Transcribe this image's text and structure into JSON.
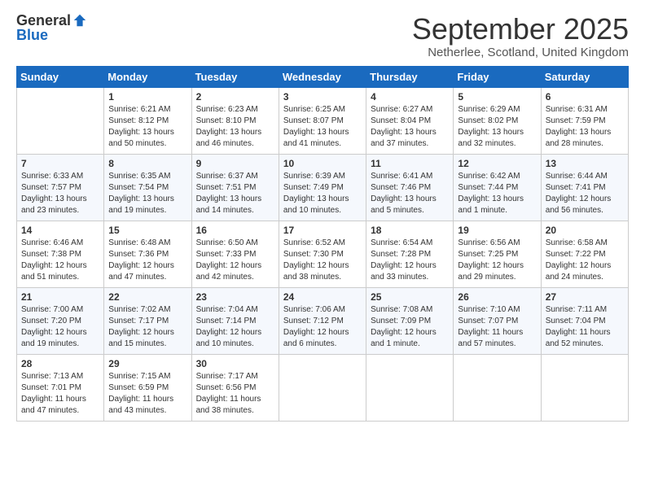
{
  "header": {
    "logo_general": "General",
    "logo_blue": "Blue",
    "title": "September 2025",
    "location": "Netherlee, Scotland, United Kingdom"
  },
  "weekdays": [
    "Sunday",
    "Monday",
    "Tuesday",
    "Wednesday",
    "Thursday",
    "Friday",
    "Saturday"
  ],
  "weeks": [
    [
      {
        "day": "",
        "text": ""
      },
      {
        "day": "1",
        "text": "Sunrise: 6:21 AM\nSunset: 8:12 PM\nDaylight: 13 hours\nand 50 minutes."
      },
      {
        "day": "2",
        "text": "Sunrise: 6:23 AM\nSunset: 8:10 PM\nDaylight: 13 hours\nand 46 minutes."
      },
      {
        "day": "3",
        "text": "Sunrise: 6:25 AM\nSunset: 8:07 PM\nDaylight: 13 hours\nand 41 minutes."
      },
      {
        "day": "4",
        "text": "Sunrise: 6:27 AM\nSunset: 8:04 PM\nDaylight: 13 hours\nand 37 minutes."
      },
      {
        "day": "5",
        "text": "Sunrise: 6:29 AM\nSunset: 8:02 PM\nDaylight: 13 hours\nand 32 minutes."
      },
      {
        "day": "6",
        "text": "Sunrise: 6:31 AM\nSunset: 7:59 PM\nDaylight: 13 hours\nand 28 minutes."
      }
    ],
    [
      {
        "day": "7",
        "text": "Sunrise: 6:33 AM\nSunset: 7:57 PM\nDaylight: 13 hours\nand 23 minutes."
      },
      {
        "day": "8",
        "text": "Sunrise: 6:35 AM\nSunset: 7:54 PM\nDaylight: 13 hours\nand 19 minutes."
      },
      {
        "day": "9",
        "text": "Sunrise: 6:37 AM\nSunset: 7:51 PM\nDaylight: 13 hours\nand 14 minutes."
      },
      {
        "day": "10",
        "text": "Sunrise: 6:39 AM\nSunset: 7:49 PM\nDaylight: 13 hours\nand 10 minutes."
      },
      {
        "day": "11",
        "text": "Sunrise: 6:41 AM\nSunset: 7:46 PM\nDaylight: 13 hours\nand 5 minutes."
      },
      {
        "day": "12",
        "text": "Sunrise: 6:42 AM\nSunset: 7:44 PM\nDaylight: 13 hours\nand 1 minute."
      },
      {
        "day": "13",
        "text": "Sunrise: 6:44 AM\nSunset: 7:41 PM\nDaylight: 12 hours\nand 56 minutes."
      }
    ],
    [
      {
        "day": "14",
        "text": "Sunrise: 6:46 AM\nSunset: 7:38 PM\nDaylight: 12 hours\nand 51 minutes."
      },
      {
        "day": "15",
        "text": "Sunrise: 6:48 AM\nSunset: 7:36 PM\nDaylight: 12 hours\nand 47 minutes."
      },
      {
        "day": "16",
        "text": "Sunrise: 6:50 AM\nSunset: 7:33 PM\nDaylight: 12 hours\nand 42 minutes."
      },
      {
        "day": "17",
        "text": "Sunrise: 6:52 AM\nSunset: 7:30 PM\nDaylight: 12 hours\nand 38 minutes."
      },
      {
        "day": "18",
        "text": "Sunrise: 6:54 AM\nSunset: 7:28 PM\nDaylight: 12 hours\nand 33 minutes."
      },
      {
        "day": "19",
        "text": "Sunrise: 6:56 AM\nSunset: 7:25 PM\nDaylight: 12 hours\nand 29 minutes."
      },
      {
        "day": "20",
        "text": "Sunrise: 6:58 AM\nSunset: 7:22 PM\nDaylight: 12 hours\nand 24 minutes."
      }
    ],
    [
      {
        "day": "21",
        "text": "Sunrise: 7:00 AM\nSunset: 7:20 PM\nDaylight: 12 hours\nand 19 minutes."
      },
      {
        "day": "22",
        "text": "Sunrise: 7:02 AM\nSunset: 7:17 PM\nDaylight: 12 hours\nand 15 minutes."
      },
      {
        "day": "23",
        "text": "Sunrise: 7:04 AM\nSunset: 7:14 PM\nDaylight: 12 hours\nand 10 minutes."
      },
      {
        "day": "24",
        "text": "Sunrise: 7:06 AM\nSunset: 7:12 PM\nDaylight: 12 hours\nand 6 minutes."
      },
      {
        "day": "25",
        "text": "Sunrise: 7:08 AM\nSunset: 7:09 PM\nDaylight: 12 hours\nand 1 minute."
      },
      {
        "day": "26",
        "text": "Sunrise: 7:10 AM\nSunset: 7:07 PM\nDaylight: 11 hours\nand 57 minutes."
      },
      {
        "day": "27",
        "text": "Sunrise: 7:11 AM\nSunset: 7:04 PM\nDaylight: 11 hours\nand 52 minutes."
      }
    ],
    [
      {
        "day": "28",
        "text": "Sunrise: 7:13 AM\nSunset: 7:01 PM\nDaylight: 11 hours\nand 47 minutes."
      },
      {
        "day": "29",
        "text": "Sunrise: 7:15 AM\nSunset: 6:59 PM\nDaylight: 11 hours\nand 43 minutes."
      },
      {
        "day": "30",
        "text": "Sunrise: 7:17 AM\nSunset: 6:56 PM\nDaylight: 11 hours\nand 38 minutes."
      },
      {
        "day": "",
        "text": ""
      },
      {
        "day": "",
        "text": ""
      },
      {
        "day": "",
        "text": ""
      },
      {
        "day": "",
        "text": ""
      }
    ]
  ]
}
